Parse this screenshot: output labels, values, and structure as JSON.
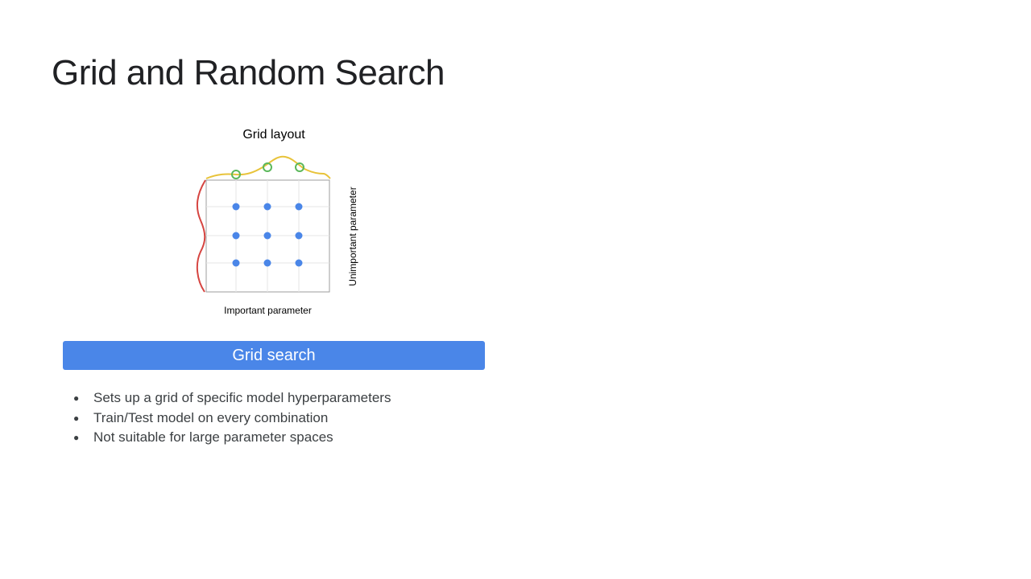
{
  "slide": {
    "title": "Grid and Random Search"
  },
  "diagram": {
    "title": "Grid layout",
    "x_axis_label": "Important parameter",
    "y_axis_label": "Unimportant parameter",
    "grid_points": 9,
    "colors": {
      "points": "#4a86e8",
      "top_curve": "#e8c33a",
      "left_curve": "#d64541",
      "markers": "#5bb85b",
      "frame": "#9e9e9e"
    }
  },
  "banner": {
    "label": "Grid search",
    "color": "#4a86e8"
  },
  "bullets": [
    "Sets up a grid of specific model hyperparameters",
    "Train/Test model on every combination",
    "Not suitable for large parameter spaces"
  ]
}
